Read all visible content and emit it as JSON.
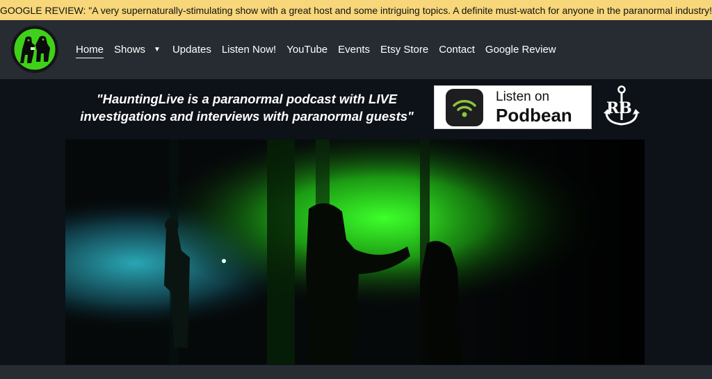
{
  "banner": {
    "text": "GOOGLE REVIEW: \"A very supernaturally-stimulating show with a great host and some intriguing topics. A definite must-watch for anyone in the paranormal industry!"
  },
  "nav": {
    "items": [
      {
        "label": "Home",
        "active": true
      },
      {
        "label": "Shows",
        "dropdown": true
      },
      {
        "label": "Updates"
      },
      {
        "label": "Listen Now!"
      },
      {
        "label": "YouTube"
      },
      {
        "label": "Events"
      },
      {
        "label": "Etsy Store"
      },
      {
        "label": "Contact"
      },
      {
        "label": "Google Review"
      }
    ],
    "caret": "▼"
  },
  "hero": {
    "tagline_line1": "\"HauntingLive is a paranormal podcast with LIVE",
    "tagline_line2": "investigations and interviews with paranormal guests\"",
    "podbean": {
      "line1": "Listen on",
      "line2": "Podbean"
    },
    "partner_logo_text": "RB"
  },
  "colors": {
    "banner_bg": "#f7d77a",
    "nav_bg": "#272c33",
    "page_bg": "#0d1118",
    "accent_green": "#39ff14",
    "podbean_green": "#8bc53f"
  },
  "icons": {
    "site_logo": "ghost-hunters-logo-icon",
    "podbean": "podbean-wifi-icon",
    "partner": "anchor-icon"
  }
}
